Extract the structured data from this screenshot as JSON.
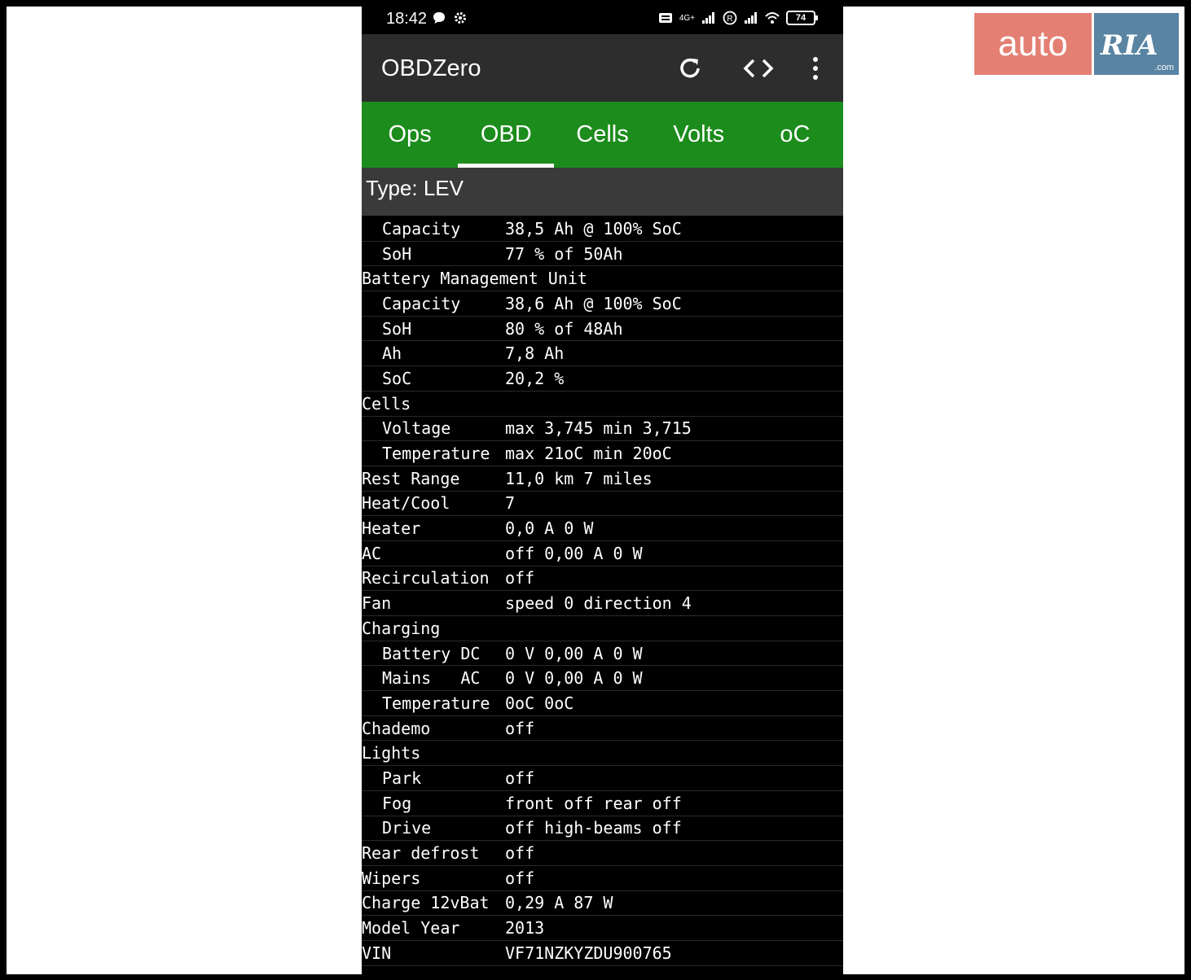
{
  "status_bar": {
    "time": "18:42",
    "battery": "74",
    "network": "4G+"
  },
  "app": {
    "title": "OBDZero",
    "actions": [
      "refresh-icon",
      "code-icon",
      "more-vert-icon"
    ]
  },
  "tabs": [
    {
      "label": "Ops",
      "active": false
    },
    {
      "label": "OBD",
      "active": true
    },
    {
      "label": "Cells",
      "active": false
    },
    {
      "label": "Volts",
      "active": false
    },
    {
      "label": "oC",
      "active": false
    }
  ],
  "type_header": "Type: LEV",
  "rows": [
    {
      "label": "Capacity",
      "value": "38,5 Ah @ 100% SoC",
      "indent": true
    },
    {
      "label": "SoH",
      "value": "77 % of 50Ah",
      "indent": true
    },
    {
      "label": "Battery Management Unit",
      "value": "",
      "indent": false
    },
    {
      "label": "Capacity",
      "value": "38,6 Ah @ 100% SoC",
      "indent": true
    },
    {
      "label": "SoH",
      "value": "80 % of 48Ah",
      "indent": true
    },
    {
      "label": "Ah",
      "value": "7,8 Ah",
      "indent": true
    },
    {
      "label": "SoC",
      "value": "20,2 %",
      "indent": true
    },
    {
      "label": "Cells",
      "value": "",
      "indent": false
    },
    {
      "label": "Voltage",
      "value": "max 3,745 min 3,715",
      "indent": true
    },
    {
      "label": "Temperature",
      "value": "max 21oC min 20oC",
      "indent": true
    },
    {
      "label": "Rest Range",
      "value": "11,0 km 7 miles",
      "indent": false
    },
    {
      "label": "Heat/Cool",
      "value": "7",
      "indent": false
    },
    {
      "label": "Heater",
      "value": "0,0 A 0 W",
      "indent": false
    },
    {
      "label": "AC",
      "value": "off 0,00 A 0 W",
      "indent": false
    },
    {
      "label": "Recirculation",
      "value": "off",
      "indent": false
    },
    {
      "label": "Fan",
      "value": "speed 0 direction 4",
      "indent": false
    },
    {
      "label": "Charging",
      "value": "",
      "indent": false
    },
    {
      "label": "Battery DC",
      "value": "0 V 0,00 A 0 W",
      "indent": true
    },
    {
      "label": "Mains   AC",
      "value": "0 V 0,00 A 0 W",
      "indent": true
    },
    {
      "label": "Temperature",
      "value": "0oC 0oC",
      "indent": true
    },
    {
      "label": "Chademo",
      "value": "off",
      "indent": false
    },
    {
      "label": "Lights",
      "value": "",
      "indent": false
    },
    {
      "label": "Park",
      "value": "off",
      "indent": true
    },
    {
      "label": "Fog",
      "value": "front off rear off",
      "indent": true
    },
    {
      "label": "Drive",
      "value": "off high-beams off",
      "indent": true
    },
    {
      "label": "Rear defrost",
      "value": "off",
      "indent": false
    },
    {
      "label": "Wipers",
      "value": "off",
      "indent": false
    },
    {
      "label": "Charge 12vBat",
      "value": "0,29 A 87 W",
      "indent": false
    },
    {
      "label": "Model Year",
      "value": "2013",
      "indent": false
    },
    {
      "label": "VIN",
      "value": "VF71NZKYZDU900765",
      "indent": false
    }
  ],
  "watermark": {
    "left": "auto",
    "right": "RIA",
    "suffix": ".com",
    "colors": {
      "left": "#e06a5b",
      "right": "#3d6f92"
    }
  },
  "colors": {
    "tab_bar": "#1c8c1c",
    "app_bar": "#2d2d2d",
    "type_header": "#3a3a3a",
    "background": "#000000"
  }
}
